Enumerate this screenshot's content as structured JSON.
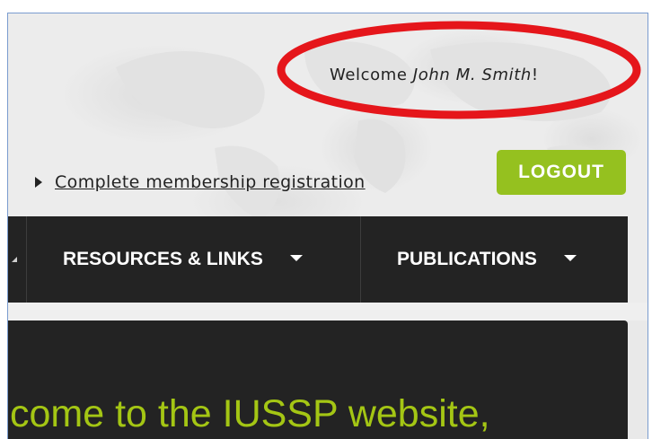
{
  "header": {
    "welcome_prefix": "Welcome ",
    "user_name": "John M. Smith",
    "welcome_suffix": "!",
    "highlight_color": "#e5161b"
  },
  "account": {
    "membership_link": "Complete membership registration",
    "logout_label": "LOGOUT"
  },
  "nav": {
    "items": [
      {
        "label": "RESOURCES & LINKS",
        "icon": "chevron-down-icon"
      },
      {
        "label": "PUBLICATIONS",
        "icon": "chevron-down-icon"
      }
    ]
  },
  "banner": {
    "text": "come to the IUSSP website,"
  },
  "colors": {
    "accent_green": "#95c11f",
    "nav_background": "#232323",
    "banner_text": "#a4c614"
  }
}
